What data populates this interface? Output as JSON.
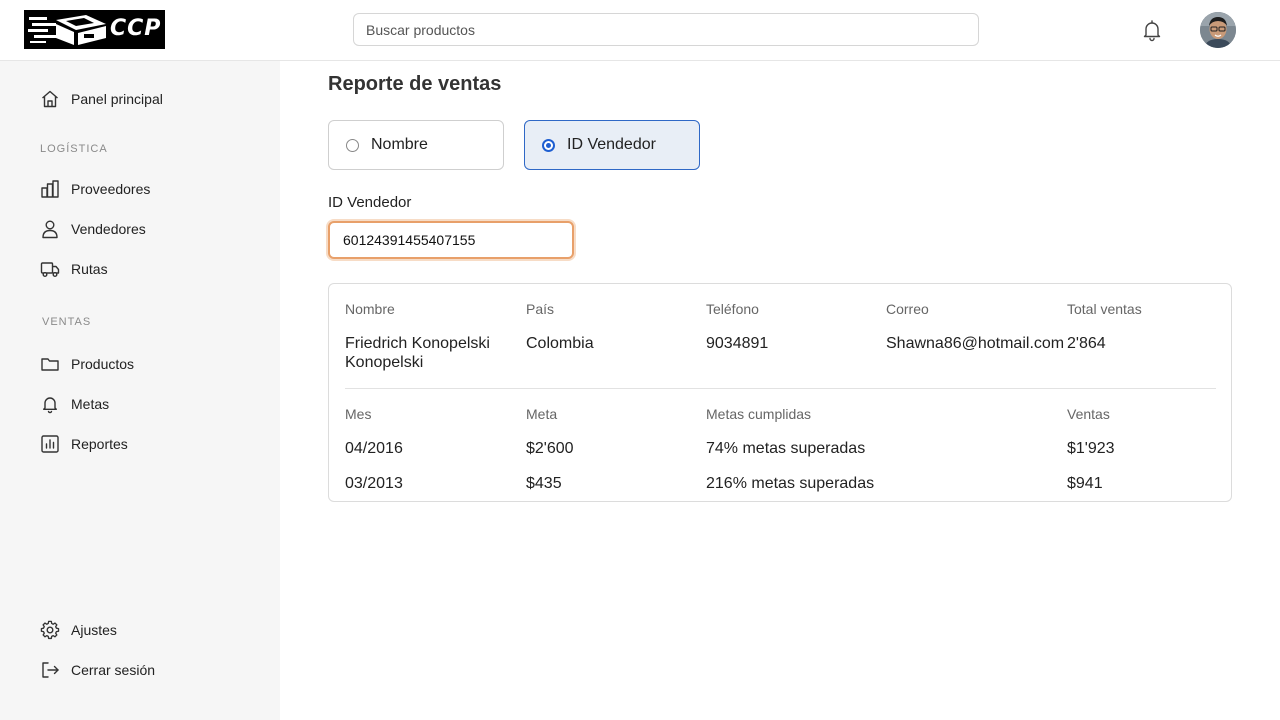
{
  "header": {
    "logo_text": "CCP",
    "search_placeholder": "Buscar productos"
  },
  "sidebar": {
    "home": "Panel principal",
    "section_logistica": "LOGÍSTICA",
    "proveedores": "Proveedores",
    "vendedores": "Vendedores",
    "rutas": "Rutas",
    "section_ventas": "VENTAS",
    "productos": "Productos",
    "metas": "Metas",
    "reportes": "Reportes",
    "ajustes": "Ajustes",
    "cerrar_sesion": "Cerrar sesión"
  },
  "main": {
    "title": "Reporte de ventas",
    "radio_options": [
      {
        "label": "Nombre",
        "selected": false
      },
      {
        "label": "ID Vendedor",
        "selected": true
      }
    ],
    "field_label": "ID Vendedor",
    "field_value": "60124391455407155"
  },
  "seller": {
    "headers": [
      "Nombre",
      "País",
      "Teléfono",
      "Correo",
      "Total ventas"
    ],
    "nombre_line1": "Friedrich Konopelski",
    "nombre_line2": "Konopelski",
    "pais": "Colombia",
    "telefono": "9034891",
    "correo": "Shawna86@hotmail.com",
    "total_ventas": "2'864"
  },
  "goals": {
    "headers": [
      "Mes",
      "Meta",
      "Metas cumplidas",
      "Ventas"
    ],
    "rows": [
      {
        "mes": "04/2016",
        "meta": "$2'600",
        "cumplidas": "74% metas superadas",
        "ventas": "$1'923"
      },
      {
        "mes": "03/2013",
        "meta": "$435",
        "cumplidas": "216% metas superadas",
        "ventas": "$941"
      }
    ]
  },
  "colors": {
    "accent": "#1f5fd1",
    "input_focus": "#e8a06a",
    "sidebar_bg": "#f6f6f6"
  }
}
